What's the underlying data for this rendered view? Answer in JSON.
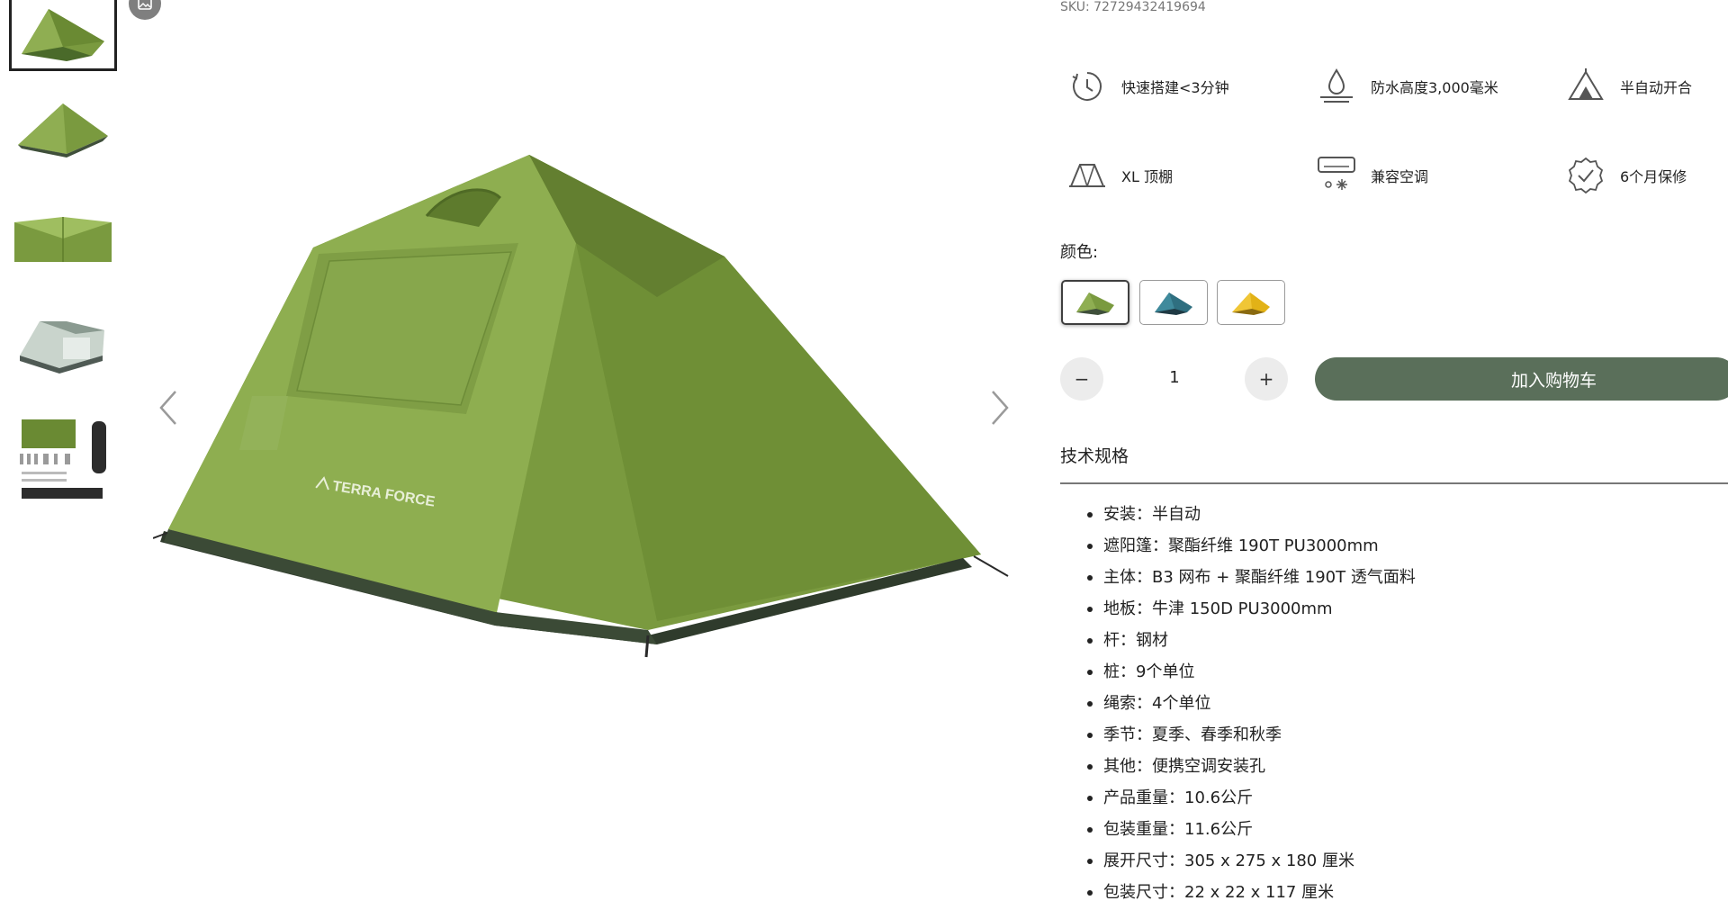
{
  "product": {
    "sku": "SKU: 72729432419694",
    "brand_logo_text": "TERRA FORCE"
  },
  "features": [
    {
      "icon": "clock-icon",
      "label": "快速搭建<3分钟"
    },
    {
      "icon": "water-drop-icon",
      "label": "防水高度3,000毫米"
    },
    {
      "icon": "tent-icon",
      "label": "半自动开合"
    },
    {
      "icon": "canopy-icon",
      "label": "XL 顶棚"
    },
    {
      "icon": "air-conditioner-icon",
      "label": "兼容空调"
    },
    {
      "icon": "warranty-badge-icon",
      "label": "6个月保修"
    }
  ],
  "color_picker": {
    "label": "颜色:",
    "options": [
      {
        "name": "green",
        "color": "#6f8f3e",
        "selected": true
      },
      {
        "name": "blue",
        "color": "#2f6f80",
        "selected": false
      },
      {
        "name": "yellow",
        "color": "#e2b217",
        "selected": false
      }
    ]
  },
  "quantity": {
    "minus_label": "−",
    "value": "1",
    "plus_label": "+"
  },
  "add_to_cart_label": "加入购物车",
  "specs": {
    "title": "技术规格",
    "items": [
      "安装：半自动",
      "遮阳篷：聚酯纤维 190T PU3000mm",
      "主体：B3 网布 + 聚酯纤维 190T 透气面料",
      "地板：牛津 150D PU3000mm",
      "杆：钢材",
      "桩：9个单位",
      "绳索：4个单位",
      "季节：夏季、春季和秋季",
      "其他：便携空调安装孔",
      "产品重量：10.6公斤",
      "包装重量：11.6公斤",
      "展开尺寸：305 x 275 x 180 厘米",
      "包装尺寸：22 x 22 x 117 厘米"
    ]
  },
  "colors": {
    "accent_button": "#5a6f5a",
    "tent_green": "#7a9a3f"
  }
}
